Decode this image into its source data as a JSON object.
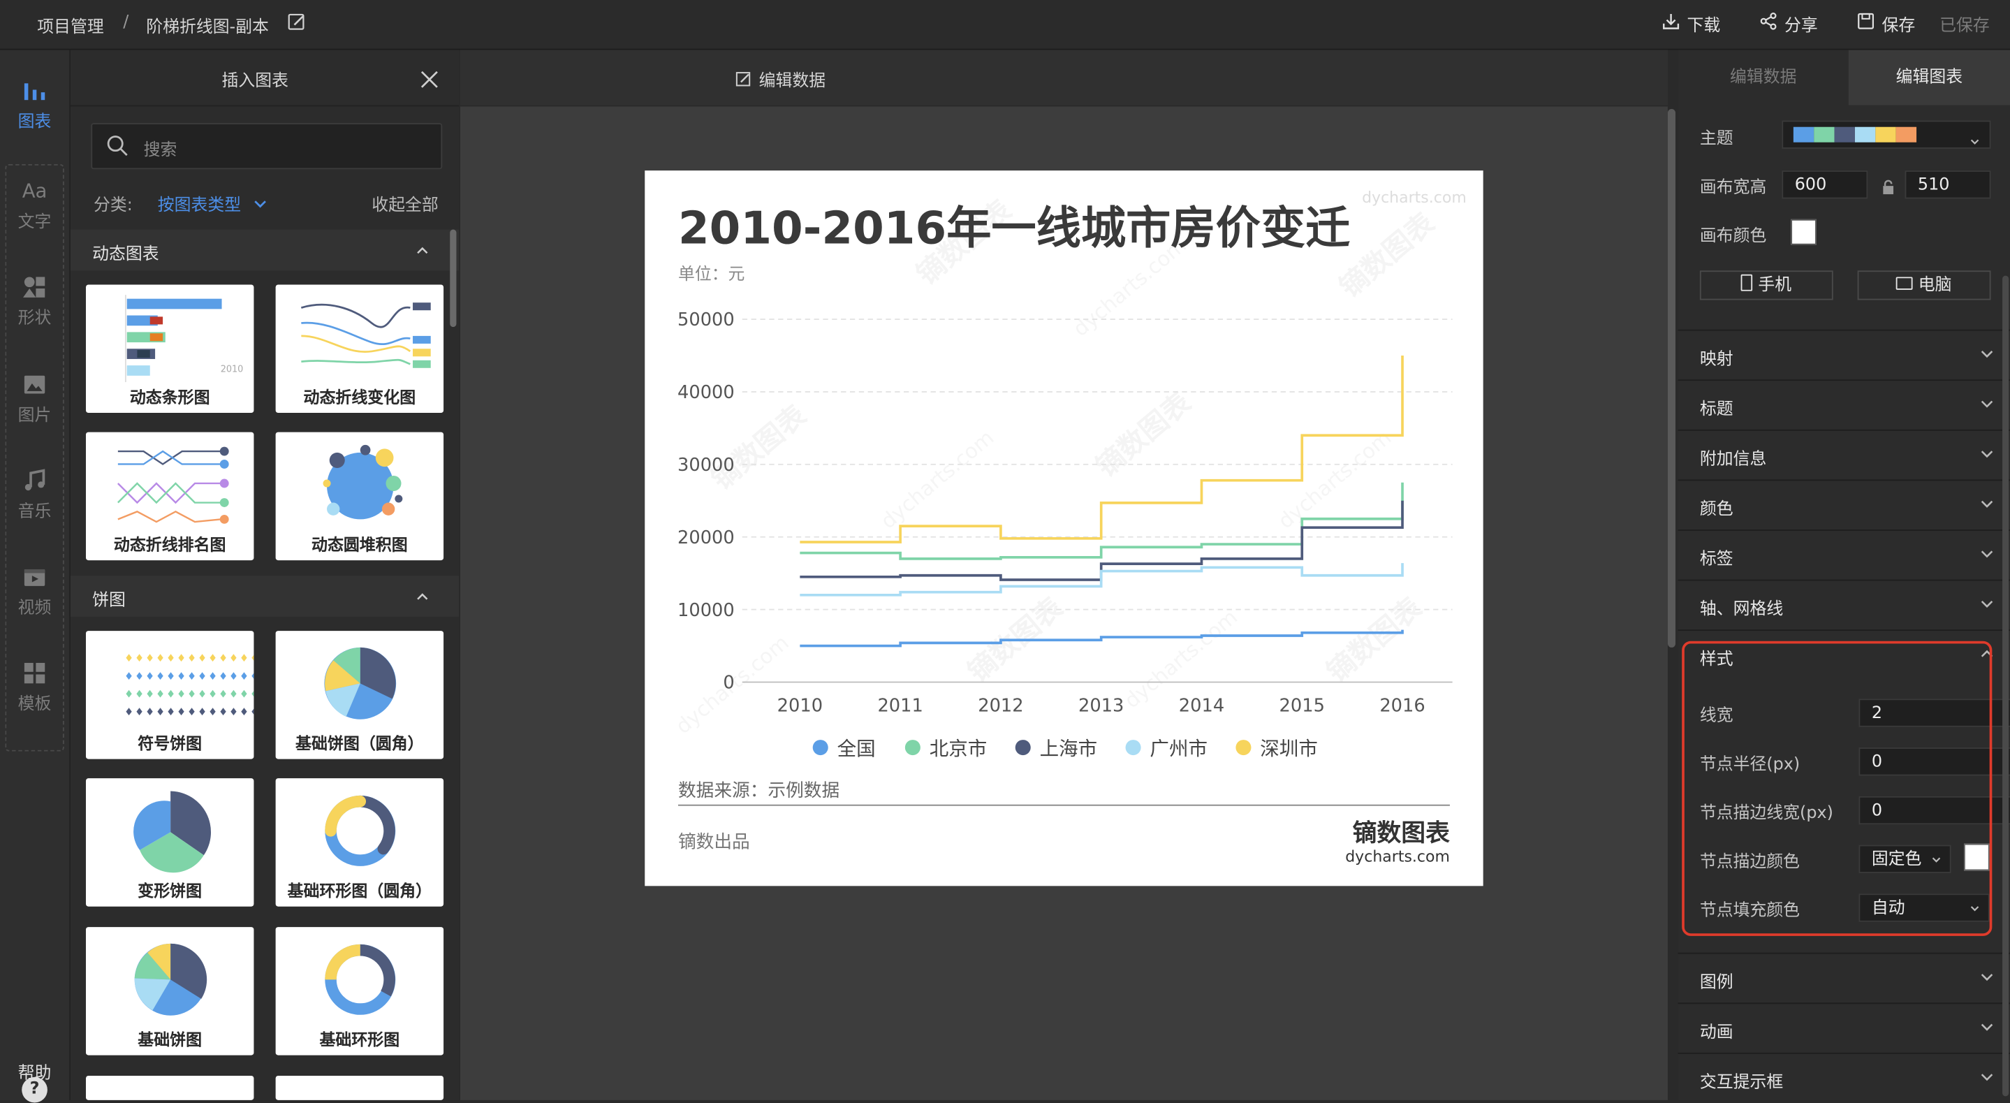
{
  "topbar": {
    "breadcrumb_root": "项目管理",
    "breadcrumb_sep": "/",
    "doc_title": "阶梯折线图-副本",
    "download": "下载",
    "share": "分享",
    "save": "保存",
    "saved_status": "已保存"
  },
  "rail": {
    "items": [
      {
        "label": "图表",
        "icon": "bar-chart-icon",
        "active": true
      },
      {
        "label": "文字",
        "icon": "text-icon"
      },
      {
        "label": "形状",
        "icon": "shape-icon"
      },
      {
        "label": "图片",
        "icon": "image-icon"
      },
      {
        "label": "音乐",
        "icon": "music-icon"
      },
      {
        "label": "视频",
        "icon": "video-icon"
      },
      {
        "label": "模板",
        "icon": "template-icon"
      }
    ],
    "help": "帮助",
    "help_glyph": "?"
  },
  "insert_panel": {
    "title": "插入图表",
    "search_placeholder": "搜索",
    "category_label": "分类:",
    "category_value": "按图表类型",
    "collapse_all": "收起全部",
    "sections": [
      {
        "title": "动态图表",
        "cards": [
          "动态条形图",
          "动态折线变化图",
          "动态折线排名图",
          "动态圆堆积图"
        ]
      },
      {
        "title": "饼图",
        "cards": [
          "符号饼图",
          "基础饼图（圆角）",
          "变形饼图",
          "基础环形图（圆角）",
          "基础饼图",
          "基础环形图"
        ]
      }
    ],
    "thumb_year": "2010"
  },
  "canvas": {
    "edit_data_label": "编辑数据"
  },
  "chart": {
    "title": "2010-2016年一线城市房价变迁",
    "unit": "单位：元",
    "source": "数据来源：示例数据",
    "producer": "镝数出品",
    "brand_cn": "镝数图表",
    "brand_en": "dycharts.com",
    "watermark": "dycharts.com"
  },
  "chart_data": {
    "type": "line",
    "step": true,
    "title": "2010-2016年一线城市房价变迁",
    "ylabel": "单位：元",
    "x": [
      "2010",
      "2011",
      "2012",
      "2013",
      "2014",
      "2015",
      "2016"
    ],
    "ylim": [
      0,
      50000
    ],
    "yticks": [
      0,
      10000,
      20000,
      30000,
      40000,
      50000
    ],
    "grid": true,
    "legend_position": "bottom",
    "series": [
      {
        "name": "全国",
        "color": "#5b9ee6",
        "values": [
          5000,
          5400,
          5800,
          6200,
          6400,
          6800,
          7200
        ]
      },
      {
        "name": "北京市",
        "color": "#7fd4a8",
        "values": [
          17800,
          17000,
          17200,
          18600,
          19000,
          22500,
          27500
        ]
      },
      {
        "name": "上海市",
        "color": "#4f5b7c",
        "values": [
          14500,
          14700,
          14100,
          16300,
          17000,
          21300,
          25000
        ]
      },
      {
        "name": "广州市",
        "color": "#a9dcf4",
        "values": [
          12000,
          12400,
          13200,
          15300,
          15800,
          14700,
          16400
        ]
      },
      {
        "name": "深圳市",
        "color": "#f7d45c",
        "values": [
          19300,
          21500,
          19800,
          24700,
          27800,
          34000,
          45000
        ]
      }
    ]
  },
  "right_panel": {
    "tabs": [
      "编辑数据",
      "编辑图表"
    ],
    "theme_label": "主题",
    "theme_colors": [
      "#5b9ee6",
      "#7fd4a8",
      "#4f5b7c",
      "#a9dcf4",
      "#f7d45c",
      "#f39c62"
    ],
    "canvas_size_label": "画布宽高",
    "canvas_width": "600",
    "canvas_height": "510",
    "canvas_color_label": "画布颜色",
    "canvas_color": "#ffffff",
    "mobile": "手机",
    "desktop": "电脑",
    "sections_top": [
      "映射",
      "标题",
      "附加信息",
      "颜色",
      "标签",
      "轴、网格线"
    ],
    "style_section": {
      "title": "样式",
      "line_width_label": "线宽",
      "line_width": "2",
      "node_radius_label": "节点半径(px)",
      "node_radius": "0",
      "node_stroke_width_label": "节点描边线宽(px)",
      "node_stroke_width": "0",
      "node_stroke_color_label": "节点描边颜色",
      "node_stroke_color_mode": "固定色",
      "node_fill_color_label": "节点填充颜色",
      "node_fill_color_mode": "自动"
    },
    "sections_bottom": [
      "图例",
      "动画",
      "交互提示框"
    ]
  }
}
